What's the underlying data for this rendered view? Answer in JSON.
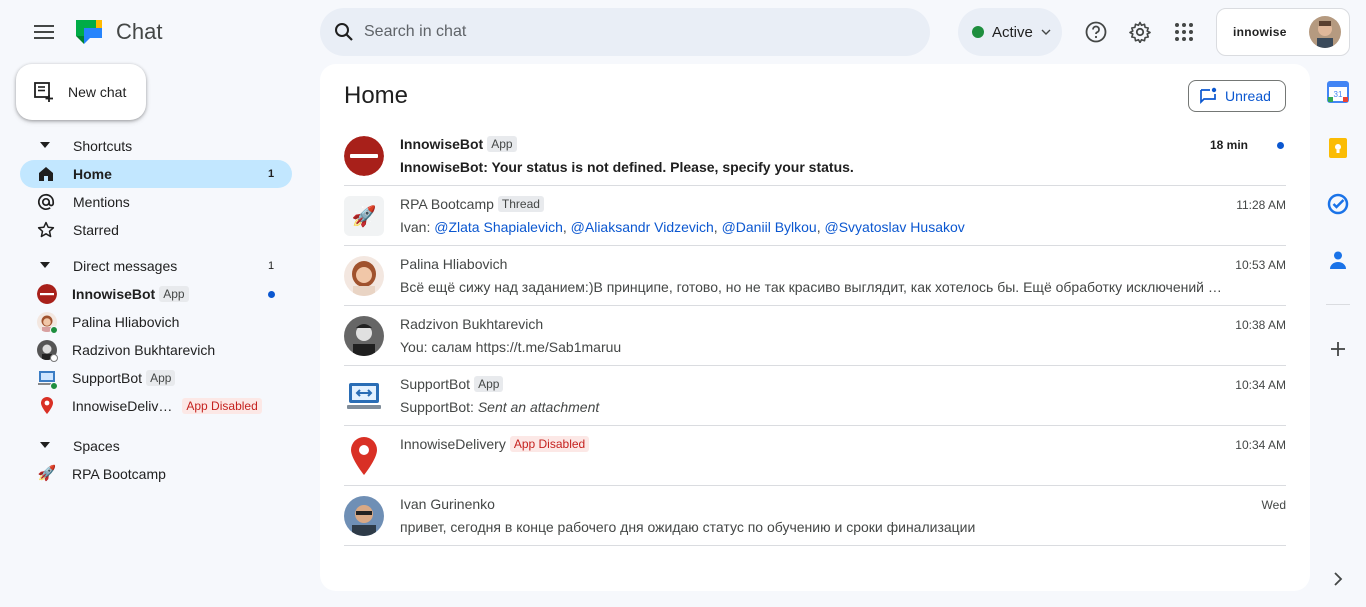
{
  "app": {
    "title": "Chat",
    "menu_icon": "hamburger-menu-icon"
  },
  "search": {
    "placeholder": "Search in chat"
  },
  "status": {
    "label": "Active",
    "color": "#1e8e3e"
  },
  "account": {
    "org": "innowise"
  },
  "new_chat": {
    "label": "New chat"
  },
  "sidebar": {
    "shortcuts": {
      "label": "Shortcuts",
      "items": [
        {
          "label": "Home",
          "count": "1",
          "icon": "home-icon"
        },
        {
          "label": "Mentions",
          "icon": "at-icon"
        },
        {
          "label": "Starred",
          "icon": "star-icon"
        }
      ]
    },
    "direct_messages": {
      "label": "Direct messages",
      "count": "1",
      "items": [
        {
          "label": "InnowiseBot",
          "chip": "App",
          "bold": true,
          "unread": true
        },
        {
          "label": "Palina Hliabovich"
        },
        {
          "label": "Radzivon Bukhtarevich"
        },
        {
          "label": "SupportBot",
          "chip": "App"
        },
        {
          "label": "InnowiseDeliv…",
          "chip": "App Disabled"
        }
      ]
    },
    "spaces": {
      "label": "Spaces",
      "items": [
        {
          "label": "RPA Bootcamp",
          "icon": "rocket-icon"
        }
      ]
    }
  },
  "main": {
    "title": "Home",
    "unread_button": "Unread",
    "conversations": [
      {
        "name": "InnowiseBot",
        "chip": "App",
        "message": "InnowiseBot: Your status is not defined. Please, specify your status.",
        "time": "18 min",
        "unread": true
      },
      {
        "name": "RPA Bootcamp",
        "chip": "Thread",
        "message_prefix": "Ivan: ",
        "mentions": [
          "@Zlata Shapialevich",
          "@Aliaksandr Vidzevich",
          "@Daniil Bylkou",
          "@Svyatoslav Husakov"
        ],
        "time": "11:28 AM"
      },
      {
        "name": "Palina Hliabovich",
        "message": "Всё ещё сижу над заданием:)В принципе, готово, но не так красиво выглядит, как хотелось бы. Ещё обработку исключений добавить надо",
        "time": "10:53 AM"
      },
      {
        "name": "Radzivon Bukhtarevich",
        "message": "You: салам https://t.me/Sab1maruu",
        "time": "10:38 AM"
      },
      {
        "name": "SupportBot",
        "chip": "App",
        "message_prefix": "SupportBot: ",
        "message_italic": "Sent an attachment",
        "time": "10:34 AM"
      },
      {
        "name": "InnowiseDelivery",
        "chip": "App Disabled",
        "message": "",
        "time": "10:34 AM"
      },
      {
        "name": "Ivan Gurinenko",
        "message": "привет, сегодня в конце рабочего дня ожидаю статус по обучению и сроки финализации",
        "time": "Wed"
      }
    ]
  },
  "right_rail": [
    "calendar-icon",
    "keep-icon",
    "tasks-icon",
    "contacts-icon",
    "add-icon",
    "expand-icon"
  ]
}
